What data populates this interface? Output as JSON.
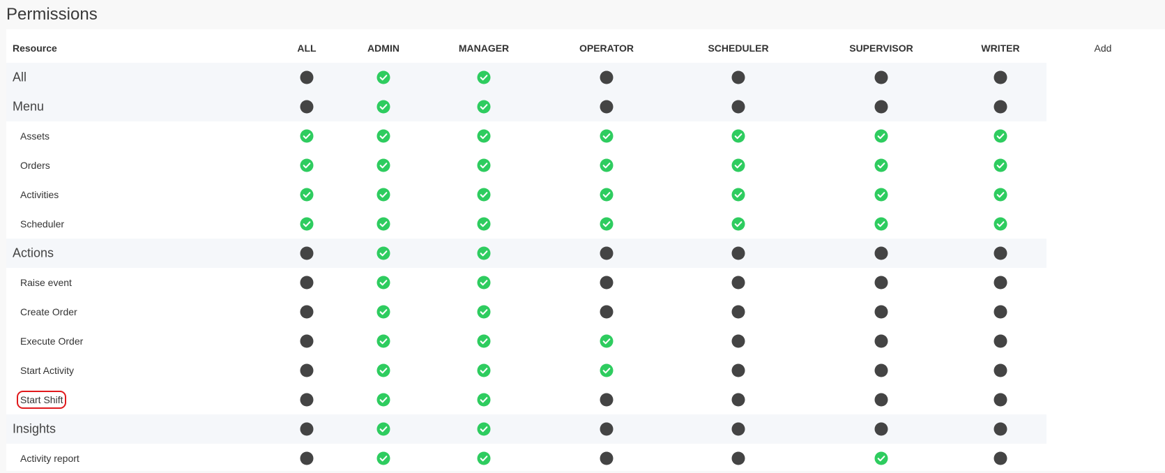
{
  "page_title": "Permissions",
  "table": {
    "resource_header": "Resource",
    "add_label": "Add",
    "columns": [
      "ALL",
      "ADMIN",
      "MANAGER",
      "OPERATOR",
      "SCHEDULER",
      "SUPERVISOR",
      "WRITER"
    ],
    "status_colors": {
      "granted": "#2ecc5f",
      "denied": "#444444"
    },
    "rows": [
      {
        "label": "All",
        "kind": "group",
        "perms": [
          0,
          1,
          1,
          0,
          0,
          0,
          0
        ]
      },
      {
        "label": "Menu",
        "kind": "group",
        "perms": [
          0,
          1,
          1,
          0,
          0,
          0,
          0
        ]
      },
      {
        "label": "Assets",
        "kind": "item",
        "perms": [
          1,
          1,
          1,
          1,
          1,
          1,
          1
        ]
      },
      {
        "label": "Orders",
        "kind": "item",
        "perms": [
          1,
          1,
          1,
          1,
          1,
          1,
          1
        ]
      },
      {
        "label": "Activities",
        "kind": "item",
        "perms": [
          1,
          1,
          1,
          1,
          1,
          1,
          1
        ]
      },
      {
        "label": "Scheduler",
        "kind": "item",
        "perms": [
          1,
          1,
          1,
          1,
          1,
          1,
          1
        ]
      },
      {
        "label": "Actions",
        "kind": "group",
        "perms": [
          0,
          1,
          1,
          0,
          0,
          0,
          0
        ]
      },
      {
        "label": "Raise event",
        "kind": "item",
        "perms": [
          0,
          1,
          1,
          0,
          0,
          0,
          0
        ]
      },
      {
        "label": "Create Order",
        "kind": "item",
        "perms": [
          0,
          1,
          1,
          0,
          0,
          0,
          0
        ]
      },
      {
        "label": "Execute Order",
        "kind": "item",
        "perms": [
          0,
          1,
          1,
          1,
          0,
          0,
          0
        ]
      },
      {
        "label": "Start Activity",
        "kind": "item",
        "perms": [
          0,
          1,
          1,
          1,
          0,
          0,
          0
        ]
      },
      {
        "label": "Start Shift",
        "kind": "item",
        "highlighted": true,
        "perms": [
          0,
          1,
          1,
          0,
          0,
          0,
          0
        ]
      },
      {
        "label": "Insights",
        "kind": "group",
        "perms": [
          0,
          1,
          1,
          0,
          0,
          0,
          0
        ]
      },
      {
        "label": "Activity report",
        "kind": "item",
        "perms": [
          0,
          1,
          1,
          0,
          0,
          1,
          0
        ]
      }
    ]
  }
}
